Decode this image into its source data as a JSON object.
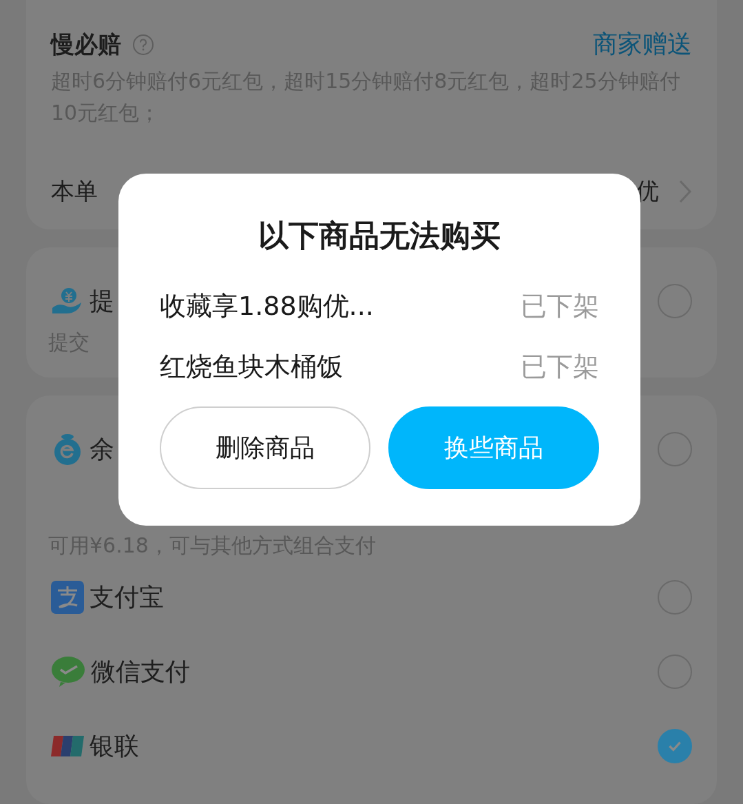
{
  "order_card": {
    "title": "慢必赔",
    "badge": "商家赠送",
    "description": "超时6分钟赔付6元红包，超时15分钟赔付8元红包，超时25分钟赔付10元红包；",
    "discount_row": {
      "label": "本单",
      "value": "优"
    }
  },
  "pay_groups": [
    {
      "options": [
        {
          "kind": "coin-hand",
          "label": "提",
          "note": "提交",
          "selected": false
        }
      ]
    },
    {
      "options": [
        {
          "kind": "wallet",
          "label": "余",
          "note": "可用¥6.18，可与其他方式组合支付",
          "selected": false
        },
        {
          "kind": "alipay",
          "label": "支付宝",
          "selected": false
        },
        {
          "kind": "wechat",
          "label": "微信支付",
          "selected": false
        },
        {
          "kind": "unionpay",
          "label": "银联",
          "selected": true
        }
      ]
    }
  ],
  "dialog": {
    "title": "以下商品无法购买",
    "items": [
      {
        "name": "收藏享1.88购优...",
        "status": "已下架"
      },
      {
        "name": "红烧鱼块木桶饭",
        "status": "已下架"
      }
    ],
    "buttons": [
      {
        "label": "删除商品",
        "kind": "secondary"
      },
      {
        "label": "换些商品",
        "kind": "primary"
      }
    ]
  }
}
